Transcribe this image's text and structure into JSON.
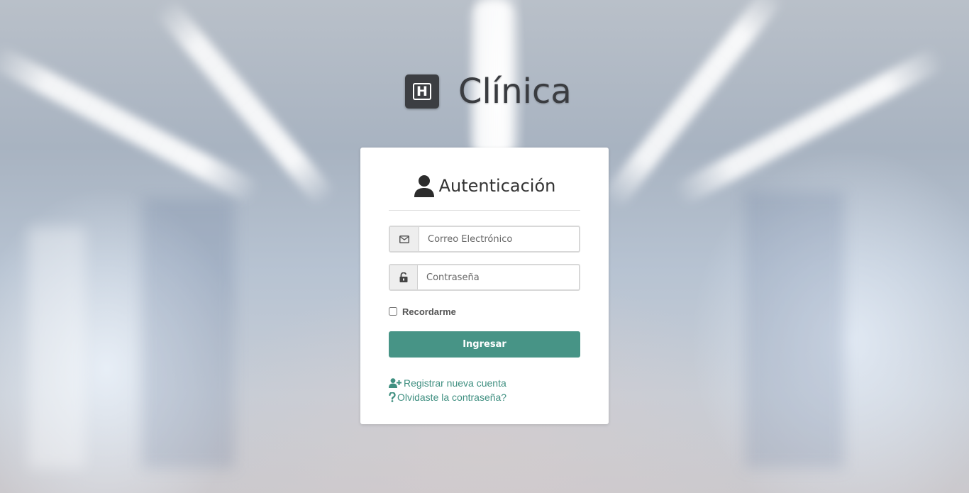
{
  "brand": {
    "logo_letter": "H",
    "name": "Clínica"
  },
  "login": {
    "title": "Autenticación",
    "email": {
      "placeholder": "Correo Electrónico",
      "value": "",
      "icon": "envelope-icon"
    },
    "password": {
      "placeholder": "Contraseña",
      "value": "",
      "icon": "unlock-icon"
    },
    "remember_label": "Recordarme",
    "remember_checked": false,
    "submit_label": "Ingresar",
    "register_link": "Registrar nueva cuenta",
    "forgot_link": "Olvidaste la contraseña?"
  },
  "colors": {
    "accent": "#479486",
    "link": "#3f8f80",
    "logo_bg": "#3c3e42"
  }
}
